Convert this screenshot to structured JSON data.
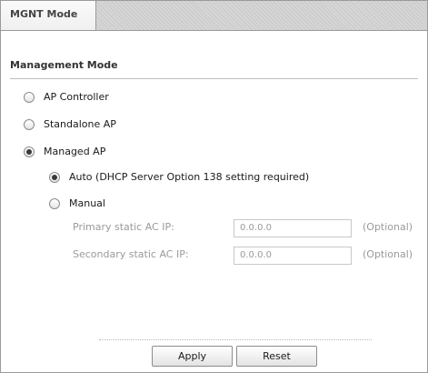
{
  "tab": {
    "label": "MGNT Mode"
  },
  "section": {
    "title": "Management Mode"
  },
  "modes": [
    {
      "label": "AP Controller",
      "checked": false
    },
    {
      "label": "Standalone AP",
      "checked": false
    },
    {
      "label": "Managed AP",
      "checked": true
    }
  ],
  "managed": {
    "auto_label": "Auto (DHCP Server Option 138 setting required)",
    "auto_checked": true,
    "manual_label": "Manual",
    "manual_checked": false,
    "primary_label": "Primary static AC IP:",
    "primary_value": "0.0.0.0",
    "secondary_label": "Secondary static AC IP:",
    "secondary_value": "0.0.0.0",
    "optional": "(Optional)"
  },
  "buttons": {
    "apply": "Apply",
    "reset": "Reset"
  }
}
